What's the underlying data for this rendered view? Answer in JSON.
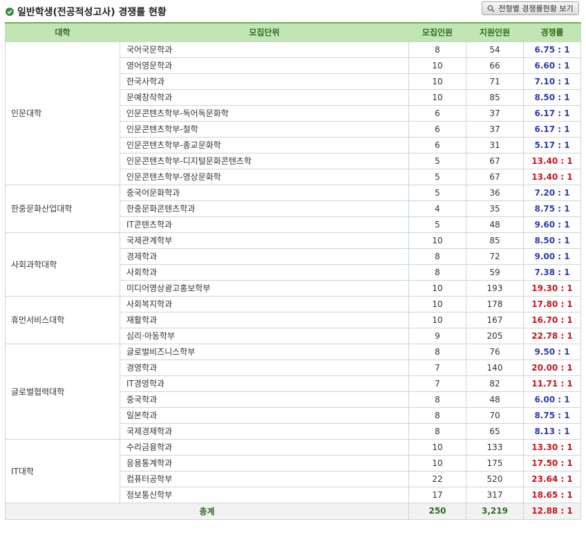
{
  "title": "일반학생(전공적성고사) 경쟁률 현황",
  "view_button_label": "전형별 경쟁률현황 보기",
  "colors": {
    "header_bg": "#c2e6b3",
    "header_text": "#2d6b22",
    "rate_low": "#2a3bb0",
    "rate_high": "#c8131d",
    "check_icon": "#3c8a3a"
  },
  "icons": {
    "title": "check-circle-icon",
    "button": "search-icon"
  },
  "columns": [
    "대학",
    "모집단위",
    "모집인원",
    "지원인원",
    "경쟁률"
  ],
  "groups": [
    {
      "college": "인문대학",
      "rows": [
        {
          "dept": "국어국문학과",
          "quota": "8",
          "applicants": "54",
          "rate": "6.75 : 1",
          "level": "low"
        },
        {
          "dept": "영어영문학과",
          "quota": "10",
          "applicants": "66",
          "rate": "6.60 : 1",
          "level": "low"
        },
        {
          "dept": "한국사학과",
          "quota": "10",
          "applicants": "71",
          "rate": "7.10 : 1",
          "level": "low"
        },
        {
          "dept": "문예창작학과",
          "quota": "10",
          "applicants": "85",
          "rate": "8.50 : 1",
          "level": "low"
        },
        {
          "dept": "인문콘텐츠학부-독어독문화학",
          "quota": "6",
          "applicants": "37",
          "rate": "6.17 : 1",
          "level": "low"
        },
        {
          "dept": "인문콘텐츠학부-철학",
          "quota": "6",
          "applicants": "37",
          "rate": "6.17 : 1",
          "level": "low"
        },
        {
          "dept": "인문콘텐츠학부-종교문화학",
          "quota": "6",
          "applicants": "31",
          "rate": "5.17 : 1",
          "level": "low"
        },
        {
          "dept": "인문콘텐츠학부-디지털문화콘텐츠학",
          "quota": "5",
          "applicants": "67",
          "rate": "13.40 : 1",
          "level": "high"
        },
        {
          "dept": "인문콘텐츠학부-영상문화학",
          "quota": "5",
          "applicants": "67",
          "rate": "13.40 : 1",
          "level": "high"
        }
      ]
    },
    {
      "college": "한중문화산업대학",
      "rows": [
        {
          "dept": "중국어문화학과",
          "quota": "5",
          "applicants": "36",
          "rate": "7.20 : 1",
          "level": "low"
        },
        {
          "dept": "한중문화콘텐츠학과",
          "quota": "4",
          "applicants": "35",
          "rate": "8.75 : 1",
          "level": "low"
        },
        {
          "dept": "IT콘텐츠학과",
          "quota": "5",
          "applicants": "48",
          "rate": "9.60 : 1",
          "level": "low"
        }
      ]
    },
    {
      "college": "사회과학대학",
      "rows": [
        {
          "dept": "국제관계학부",
          "quota": "10",
          "applicants": "85",
          "rate": "8.50 : 1",
          "level": "low"
        },
        {
          "dept": "경제학과",
          "quota": "8",
          "applicants": "72",
          "rate": "9.00 : 1",
          "level": "low"
        },
        {
          "dept": "사회학과",
          "quota": "8",
          "applicants": "59",
          "rate": "7.38 : 1",
          "level": "low"
        },
        {
          "dept": "미디어영상광고홍보학부",
          "quota": "10",
          "applicants": "193",
          "rate": "19.30 : 1",
          "level": "high"
        }
      ]
    },
    {
      "college": "휴먼서비스대학",
      "rows": [
        {
          "dept": "사회복지학과",
          "quota": "10",
          "applicants": "178",
          "rate": "17.80 : 1",
          "level": "high"
        },
        {
          "dept": "재활학과",
          "quota": "10",
          "applicants": "167",
          "rate": "16.70 : 1",
          "level": "high"
        },
        {
          "dept": "심리·아동학부",
          "quota": "9",
          "applicants": "205",
          "rate": "22.78 : 1",
          "level": "high"
        }
      ]
    },
    {
      "college": "글로벌협력대학",
      "rows": [
        {
          "dept": "글로벌비즈니스학부",
          "quota": "8",
          "applicants": "76",
          "rate": "9.50 : 1",
          "level": "low"
        },
        {
          "dept": "경영학과",
          "quota": "7",
          "applicants": "140",
          "rate": "20.00 : 1",
          "level": "high"
        },
        {
          "dept": "IT경영학과",
          "quota": "7",
          "applicants": "82",
          "rate": "11.71 : 1",
          "level": "high"
        },
        {
          "dept": "중국학과",
          "quota": "8",
          "applicants": "48",
          "rate": "6.00 : 1",
          "level": "low"
        },
        {
          "dept": "일본학과",
          "quota": "8",
          "applicants": "70",
          "rate": "8.75 : 1",
          "level": "low"
        },
        {
          "dept": "국제경제학과",
          "quota": "8",
          "applicants": "65",
          "rate": "8.13 : 1",
          "level": "low"
        }
      ]
    },
    {
      "college": "IT대학",
      "rows": [
        {
          "dept": "수리금융학과",
          "quota": "10",
          "applicants": "133",
          "rate": "13.30 : 1",
          "level": "high"
        },
        {
          "dept": "응용통계학과",
          "quota": "10",
          "applicants": "175",
          "rate": "17.50 : 1",
          "level": "high"
        },
        {
          "dept": "컴퓨터공학부",
          "quota": "22",
          "applicants": "520",
          "rate": "23.64 : 1",
          "level": "high"
        },
        {
          "dept": "정보통신학부",
          "quota": "17",
          "applicants": "317",
          "rate": "18.65 : 1",
          "level": "high"
        }
      ]
    }
  ],
  "total": {
    "label": "총계",
    "quota": "250",
    "applicants": "3,219",
    "rate": "12.88 : 1"
  }
}
